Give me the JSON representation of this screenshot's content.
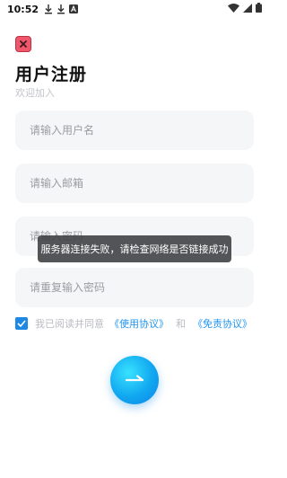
{
  "status_bar": {
    "time": "10:52",
    "icons": [
      "download-icon",
      "download-icon",
      "notification-a-icon"
    ],
    "right_icons": [
      "wifi-icon",
      "signal-icon",
      "battery-icon"
    ]
  },
  "header": {
    "title": "用户注册",
    "subtitle": "欢迎加入",
    "close_icon": "close-icon"
  },
  "form": {
    "username_placeholder": "请输入用户名",
    "email_placeholder": "请输入邮箱",
    "password_placeholder": "请输入密码",
    "confirm_password_placeholder": "请重复输入密码"
  },
  "agreement": {
    "checked": true,
    "prefix": "我已阅读并同意",
    "terms_link": "《使用协议》",
    "and": "和",
    "disclaimer_link": "《免责协议》"
  },
  "submit": {
    "icon": "arrow-right-icon"
  },
  "toast": {
    "message": "服务器连接失败，请检查网络是否链接成功"
  },
  "colors": {
    "accent": "#2196f3",
    "close_button": "#f0576a",
    "field_background": "#f5f6f8",
    "toast_background": "#3c3e40"
  }
}
